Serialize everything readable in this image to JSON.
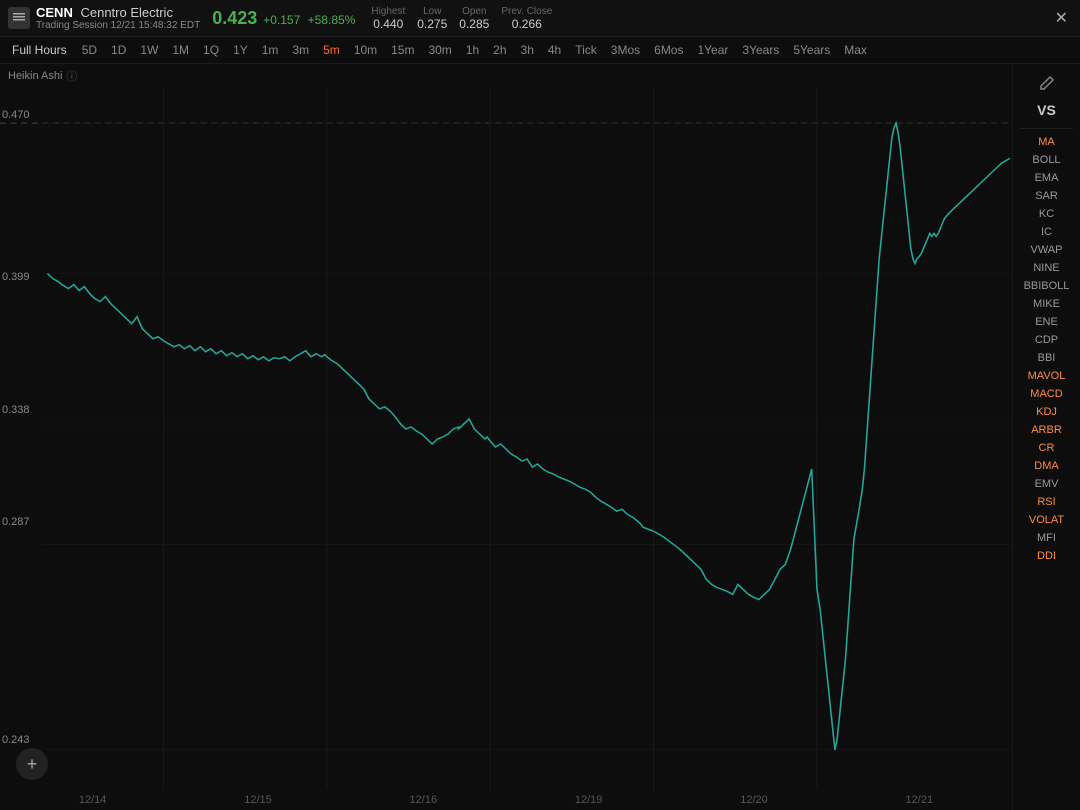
{
  "header": {
    "ticker": "CENN",
    "company": "Cenntro Electric",
    "session": "Trading Session 12/21 15:48:32 EDT",
    "price": "0.423",
    "change": "+0.157",
    "change_pct": "+58.85%",
    "highest_label": "Highest",
    "high": "0.440",
    "low_label": "Low",
    "low": "0.275",
    "open_label": "Open",
    "open": "0.285",
    "prev_close_label": "Prev. Close",
    "prev_close": "0.266",
    "close_icon": "✕"
  },
  "timebar": {
    "buttons": [
      {
        "label": "Full Hours",
        "id": "full-hours",
        "active": false
      },
      {
        "label": "5D",
        "id": "5d",
        "active": false
      },
      {
        "label": "1D",
        "id": "1d",
        "active": false
      },
      {
        "label": "1W",
        "id": "1w",
        "active": false
      },
      {
        "label": "1M",
        "id": "1m",
        "active": false
      },
      {
        "label": "1Q",
        "id": "1q",
        "active": false
      },
      {
        "label": "1Y",
        "id": "1y",
        "active": false
      },
      {
        "label": "1m",
        "id": "1min",
        "active": false
      },
      {
        "label": "3m",
        "id": "3min",
        "active": false
      },
      {
        "label": "5m",
        "id": "5min",
        "active": true
      },
      {
        "label": "10m",
        "id": "10min",
        "active": false
      },
      {
        "label": "15m",
        "id": "15min",
        "active": false
      },
      {
        "label": "30m",
        "id": "30min",
        "active": false
      },
      {
        "label": "1h",
        "id": "1h",
        "active": false
      },
      {
        "label": "2h",
        "id": "2h",
        "active": false
      },
      {
        "label": "3h",
        "id": "3h",
        "active": false
      },
      {
        "label": "4h",
        "id": "4h",
        "active": false
      },
      {
        "label": "Tick",
        "id": "tick",
        "active": false
      },
      {
        "label": "3Mos",
        "id": "3mos",
        "active": false
      },
      {
        "label": "6Mos",
        "id": "6mos",
        "active": false
      },
      {
        "label": "1Year",
        "id": "1year",
        "active": false
      },
      {
        "label": "3Years",
        "id": "3years",
        "active": false
      },
      {
        "label": "5Years",
        "id": "5years",
        "active": false
      },
      {
        "label": "Max",
        "id": "max",
        "active": false
      }
    ]
  },
  "chart": {
    "heikin_label": "Heikin Ashi",
    "price_levels": [
      {
        "value": "0.470",
        "y_pct": 5
      },
      {
        "value": "0.399",
        "y_pct": 28
      },
      {
        "value": "0.338",
        "y_pct": 47
      },
      {
        "value": "0.287",
        "y_pct": 63
      },
      {
        "value": "0.243",
        "y_pct": 95
      }
    ],
    "dates": [
      "12/14",
      "12/15",
      "12/16",
      "12/19",
      "12/20",
      "12/21"
    ]
  },
  "side_panel": {
    "vs_label": "VS",
    "pencil_icon": "✏",
    "indicators": [
      {
        "label": "MA",
        "orange": true
      },
      {
        "label": "BOLL",
        "orange": false
      },
      {
        "label": "EMA",
        "orange": false
      },
      {
        "label": "SAR",
        "orange": false
      },
      {
        "label": "KC",
        "orange": false
      },
      {
        "label": "IC",
        "orange": false
      },
      {
        "label": "VWAP",
        "orange": false
      },
      {
        "label": "NINE",
        "orange": false
      },
      {
        "label": "BBIBOLL",
        "orange": false
      },
      {
        "label": "MIKE",
        "orange": false
      },
      {
        "label": "ENE",
        "orange": false
      },
      {
        "label": "CDP",
        "orange": false
      },
      {
        "label": "BBI",
        "orange": false
      },
      {
        "label": "MAVOL",
        "orange": true
      },
      {
        "label": "MACD",
        "orange": true
      },
      {
        "label": "KDJ",
        "orange": true
      },
      {
        "label": "ARBR",
        "orange": true
      },
      {
        "label": "CR",
        "orange": true
      },
      {
        "label": "DMA",
        "orange": true
      },
      {
        "label": "EMV",
        "orange": false
      },
      {
        "label": "RSI",
        "orange": true
      },
      {
        "label": "VOLAT",
        "orange": true
      },
      {
        "label": "MFI",
        "orange": false
      },
      {
        "label": "DDI",
        "orange": true
      }
    ]
  },
  "add_btn_label": "+"
}
